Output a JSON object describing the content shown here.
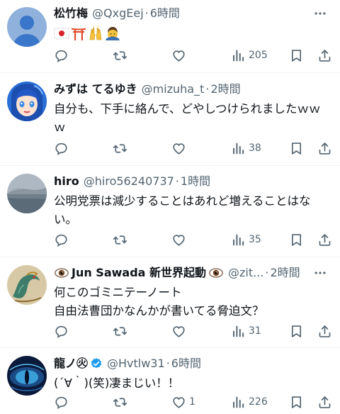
{
  "posts": [
    {
      "name": "松竹梅",
      "handle": "@QxgEej",
      "time": "6時間",
      "emoji": [
        "japan-flag",
        "torii-gate",
        "raising-hands",
        "ok-gesture-person"
      ],
      "text": "",
      "views": "205",
      "likes": "",
      "avatar": "default-profile"
    },
    {
      "name": "みずは てるゆき",
      "handle": "@mizuha_t",
      "time": "2時間",
      "text": "自分も、下手に絡んで、どやしつけられましたｗｗｗ",
      "views": "38",
      "likes": "",
      "avatar": "anime-blue-hair"
    },
    {
      "name": "hiro",
      "handle": "@hiro56240737",
      "time": "1時間",
      "text": "公明党票は減少することはあれど増えることはない。",
      "views": "35",
      "likes": "",
      "avatar": "landscape-photo"
    },
    {
      "name_prefix_emoji": "eye",
      "name": "Jun Sawada 新世界起動",
      "name_suffix_emoji": "eye",
      "handle": "@zit...",
      "time": "2時間",
      "text_lines": [
        "何このゴミニテーノート",
        "自由法曹団かなんかが書いてる脅迫文？"
      ],
      "views": "31",
      "likes": "",
      "avatar": "dragon-art"
    },
    {
      "name": "龍ノ㊋",
      "verified": true,
      "handle": "@Hvtlw31",
      "time": "6時間",
      "text": "(´∀｀)(笑)凄まじい！！",
      "views": "226",
      "likes": "1",
      "avatar": "dragon-eye"
    }
  ],
  "icons": {
    "reply": "reply-icon",
    "repost": "repost-icon",
    "like": "heart-icon",
    "views": "views-chart-icon",
    "bookmark": "bookmark-icon",
    "share": "share-icon",
    "more": "more-icon"
  },
  "colors": {
    "text": "#0f1419",
    "secondary": "#536471",
    "divider": "#eff3f4",
    "verified": "#1d9bf0"
  }
}
